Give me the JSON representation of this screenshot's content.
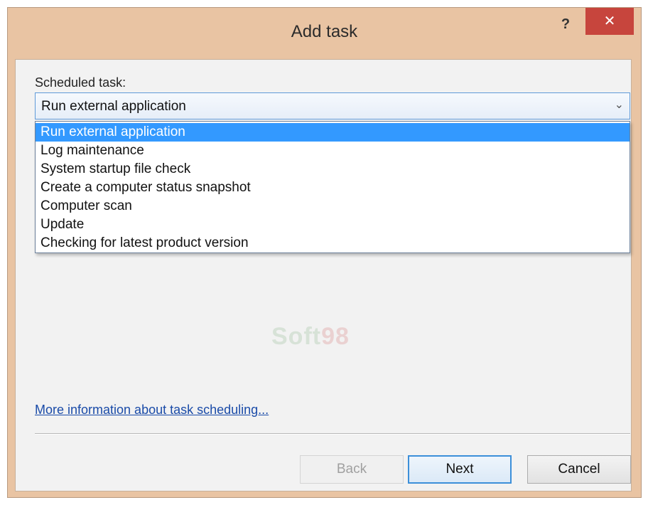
{
  "window": {
    "title": "Add task",
    "help_label": "?",
    "close_label": "✕"
  },
  "form": {
    "scheduled_task_label": "Scheduled task:",
    "combo_value": "Run external application",
    "combo_arrow": "⌄",
    "options": [
      "Run external application",
      "Log maintenance",
      "System startup file check",
      "Create a computer status snapshot",
      "Computer scan",
      "Update",
      "Checking for latest product version"
    ],
    "selected_index": 0
  },
  "watermark": {
    "text_a": "Soft",
    "text_b": "98"
  },
  "footer": {
    "info_link": "More information about task scheduling...",
    "back_label": "Back",
    "next_label": "Next",
    "cancel_label": "Cancel"
  }
}
